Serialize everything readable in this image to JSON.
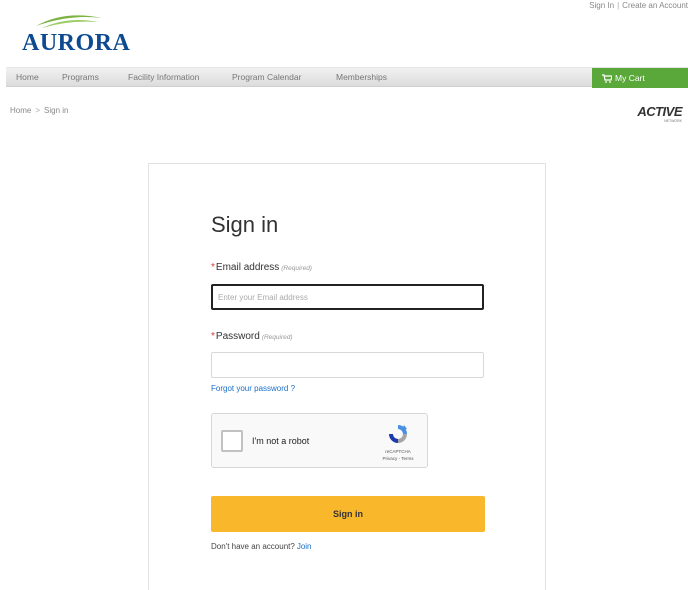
{
  "top_links": {
    "sign_in": "Sign In",
    "separator": "|",
    "create_account": "Create an Account"
  },
  "logo": {
    "text": "AURORA"
  },
  "nav": {
    "items": [
      "Home",
      "Programs",
      "Facility Information",
      "Program Calendar",
      "Memberships"
    ],
    "cart_label": "My Cart"
  },
  "breadcrumb": {
    "home": "Home",
    "arrow": ">",
    "current": "Sign in"
  },
  "active_logo": {
    "text": "ACTIVE",
    "sub": "NETWORK"
  },
  "form": {
    "title": "Sign in",
    "email_label": "Email address",
    "email_required": "(Required)",
    "email_placeholder": "Enter your Email address",
    "password_label": "Password",
    "password_required": "(Required)",
    "forgot_link": "Forgot your password ?",
    "recaptcha_label": "I'm not a robot",
    "recaptcha_brand": "reCAPTCHA",
    "recaptcha_terms": "Privacy - Terms",
    "submit_label": "Sign in",
    "no_account_text": "Don't have an account?",
    "join_link": "Join"
  },
  "colors": {
    "brand_blue": "#0d4a8f",
    "cart_green": "#5aa83a",
    "button_yellow": "#f9b72c",
    "link_blue": "#1a6fc9",
    "required_red": "#d33333"
  },
  "icons": {
    "cart": "cart-icon",
    "recaptcha": "recaptcha-logo-icon"
  }
}
